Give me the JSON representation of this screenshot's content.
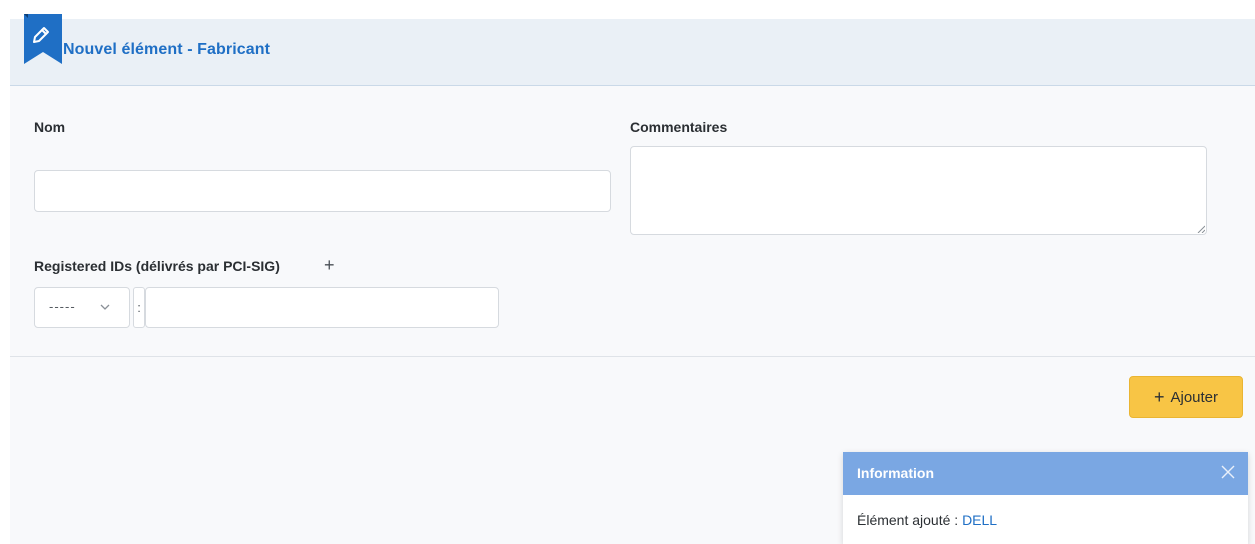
{
  "header": {
    "title": "Nouvel élément - Fabricant",
    "icon": "edit-icon",
    "accent_color": "#1f6fc5"
  },
  "form": {
    "nom": {
      "label": "Nom",
      "value": ""
    },
    "commentaires": {
      "label": "Commentaires",
      "value": ""
    },
    "registered_ids": {
      "label": "Registered IDs (délivrés par PCI-SIG)",
      "add_icon": "plus-icon",
      "select_value": "-----",
      "separator": ":",
      "value": ""
    }
  },
  "actions": {
    "add_label": "Ajouter",
    "add_color": "#f8c545"
  },
  "toast": {
    "title": "Information",
    "message_prefix": "Élément ajouté :",
    "message_value": "DELL",
    "header_color": "#7aa7e3"
  }
}
